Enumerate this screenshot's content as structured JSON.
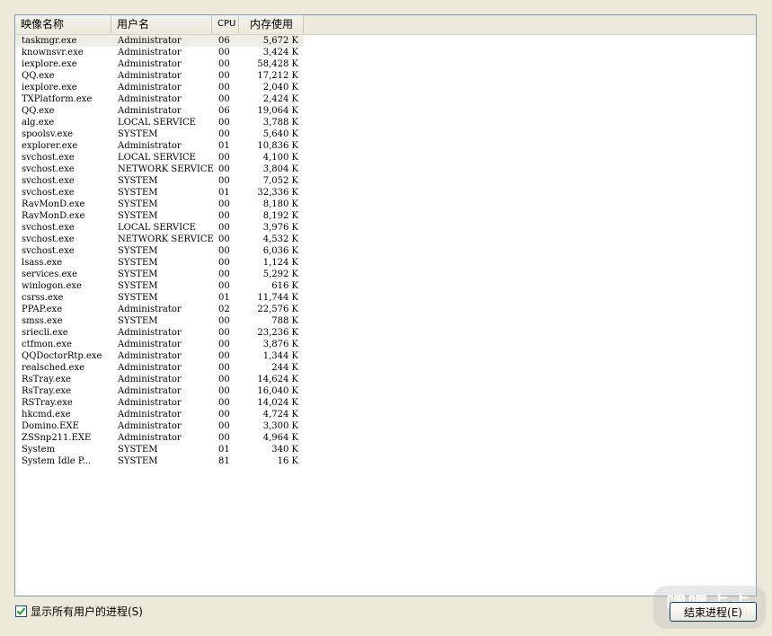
{
  "columns": {
    "image_name": "映像名称",
    "user_name": "用户名",
    "cpu": "CPU",
    "memory": "内存使用"
  },
  "processes": [
    {
      "name": "taskmgr.exe",
      "user": "Administrator",
      "cpu": "06",
      "mem": "5,672 K"
    },
    {
      "name": "knownsvr.exe",
      "user": "Administrator",
      "cpu": "00",
      "mem": "3,424 K"
    },
    {
      "name": "iexplore.exe",
      "user": "Administrator",
      "cpu": "00",
      "mem": "58,428 K"
    },
    {
      "name": "QQ.exe",
      "user": "Administrator",
      "cpu": "00",
      "mem": "17,212 K"
    },
    {
      "name": "iexplore.exe",
      "user": "Administrator",
      "cpu": "00",
      "mem": "2,040 K"
    },
    {
      "name": "TXPlatform.exe",
      "user": "Administrator",
      "cpu": "00",
      "mem": "2,424 K"
    },
    {
      "name": "QQ.exe",
      "user": "Administrator",
      "cpu": "06",
      "mem": "19,064 K"
    },
    {
      "name": "alg.exe",
      "user": "LOCAL SERVICE",
      "cpu": "00",
      "mem": "3,788 K"
    },
    {
      "name": "spoolsv.exe",
      "user": "SYSTEM",
      "cpu": "00",
      "mem": "5,640 K"
    },
    {
      "name": "explorer.exe",
      "user": "Administrator",
      "cpu": "01",
      "mem": "10,836 K"
    },
    {
      "name": "svchost.exe",
      "user": "LOCAL SERVICE",
      "cpu": "00",
      "mem": "4,100 K"
    },
    {
      "name": "svchost.exe",
      "user": "NETWORK SERVICE",
      "cpu": "00",
      "mem": "3,804 K"
    },
    {
      "name": "svchost.exe",
      "user": "SYSTEM",
      "cpu": "00",
      "mem": "7,052 K"
    },
    {
      "name": "svchost.exe",
      "user": "SYSTEM",
      "cpu": "01",
      "mem": "32,336 K"
    },
    {
      "name": "RavMonD.exe",
      "user": "SYSTEM",
      "cpu": "00",
      "mem": "8,180 K"
    },
    {
      "name": "RavMonD.exe",
      "user": "SYSTEM",
      "cpu": "00",
      "mem": "8,192 K"
    },
    {
      "name": "svchost.exe",
      "user": "LOCAL SERVICE",
      "cpu": "00",
      "mem": "3,976 K"
    },
    {
      "name": "svchost.exe",
      "user": "NETWORK SERVICE",
      "cpu": "00",
      "mem": "4,532 K"
    },
    {
      "name": "svchost.exe",
      "user": "SYSTEM",
      "cpu": "00",
      "mem": "6,036 K"
    },
    {
      "name": "lsass.exe",
      "user": "SYSTEM",
      "cpu": "00",
      "mem": "1,124 K"
    },
    {
      "name": "services.exe",
      "user": "SYSTEM",
      "cpu": "00",
      "mem": "5,292 K"
    },
    {
      "name": "winlogon.exe",
      "user": "SYSTEM",
      "cpu": "00",
      "mem": "616 K"
    },
    {
      "name": "csrss.exe",
      "user": "SYSTEM",
      "cpu": "01",
      "mem": "11,744 K"
    },
    {
      "name": "PPAP.exe",
      "user": "Administrator",
      "cpu": "02",
      "mem": "22,576 K"
    },
    {
      "name": "smss.exe",
      "user": "SYSTEM",
      "cpu": "00",
      "mem": "788 K"
    },
    {
      "name": "sriecli.exe",
      "user": "Administrator",
      "cpu": "00",
      "mem": "23,236 K"
    },
    {
      "name": "ctfmon.exe",
      "user": "Administrator",
      "cpu": "00",
      "mem": "3,876 K"
    },
    {
      "name": "QQDoctorRtp.exe",
      "user": "Administrator",
      "cpu": "00",
      "mem": "1,344 K"
    },
    {
      "name": "realsched.exe",
      "user": "Administrator",
      "cpu": "00",
      "mem": "244 K"
    },
    {
      "name": "RsTray.exe",
      "user": "Administrator",
      "cpu": "00",
      "mem": "14,624 K"
    },
    {
      "name": "RsTray.exe",
      "user": "Administrator",
      "cpu": "00",
      "mem": "16,040 K"
    },
    {
      "name": "RSTray.exe",
      "user": "Administrator",
      "cpu": "00",
      "mem": "14,024 K"
    },
    {
      "name": "hkcmd.exe",
      "user": "Administrator",
      "cpu": "00",
      "mem": "4,724 K"
    },
    {
      "name": "Domino.EXE",
      "user": "Administrator",
      "cpu": "00",
      "mem": "3,300 K"
    },
    {
      "name": "ZSSnp211.EXE",
      "user": "Administrator",
      "cpu": "00",
      "mem": "4,964 K"
    },
    {
      "name": "System",
      "user": "SYSTEM",
      "cpu": "01",
      "mem": "340 K"
    },
    {
      "name": "System Idle P...",
      "user": "SYSTEM",
      "cpu": "81",
      "mem": "16 K"
    }
  ],
  "footer": {
    "show_all_label": "显示所有用户的进程(S)",
    "show_all_checked": true,
    "end_process_label": "结束进程(E)"
  },
  "watermark": "嘿嘿卡卡"
}
